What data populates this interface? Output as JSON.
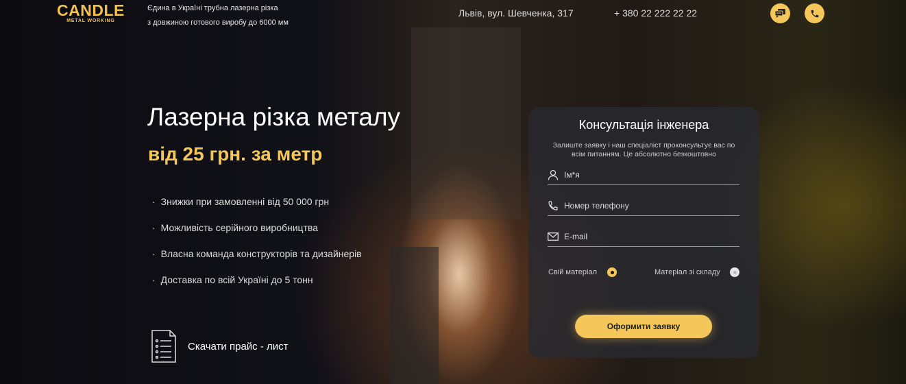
{
  "header": {
    "logo": "CANDLE",
    "logo_sub": "METAL WORKING",
    "tagline_1": "Єдина в Україні трубна лазерна різка",
    "tagline_2": "з довжиною готового виробу до 6000 мм",
    "address": "Львів, вул. Шевченка, 317",
    "phone": "+ 380 22 222 22 22",
    "icons": [
      "chat-icon",
      "phone-icon"
    ]
  },
  "hero": {
    "title": "Лазерна різка металу",
    "price": "від 25 грн. за метр",
    "bullets": [
      "Знижки при замовленні від 50 000 грн",
      "Можливість серійного виробництва",
      "Власна команда конструкторів та дизайнерів",
      "Доставка по всій Україні до 5 тонн"
    ],
    "download": "Скачати прайс - лист"
  },
  "form": {
    "title": "Консультація інженера",
    "description": "Залиште заявку і наш спеціаліст проконсультує вас по всім питанням. Це абсолютно безкоштовно",
    "name_placeholder": "Ім*я",
    "phone_placeholder": "Номер телефону",
    "email_placeholder": "E-mail",
    "option_own": "Свій матеріал",
    "option_stock": "Матеріал зі складу",
    "selected": "Свій матеріал",
    "submit": "Оформити заявку"
  },
  "colors": {
    "accent": "#f5c75a"
  }
}
